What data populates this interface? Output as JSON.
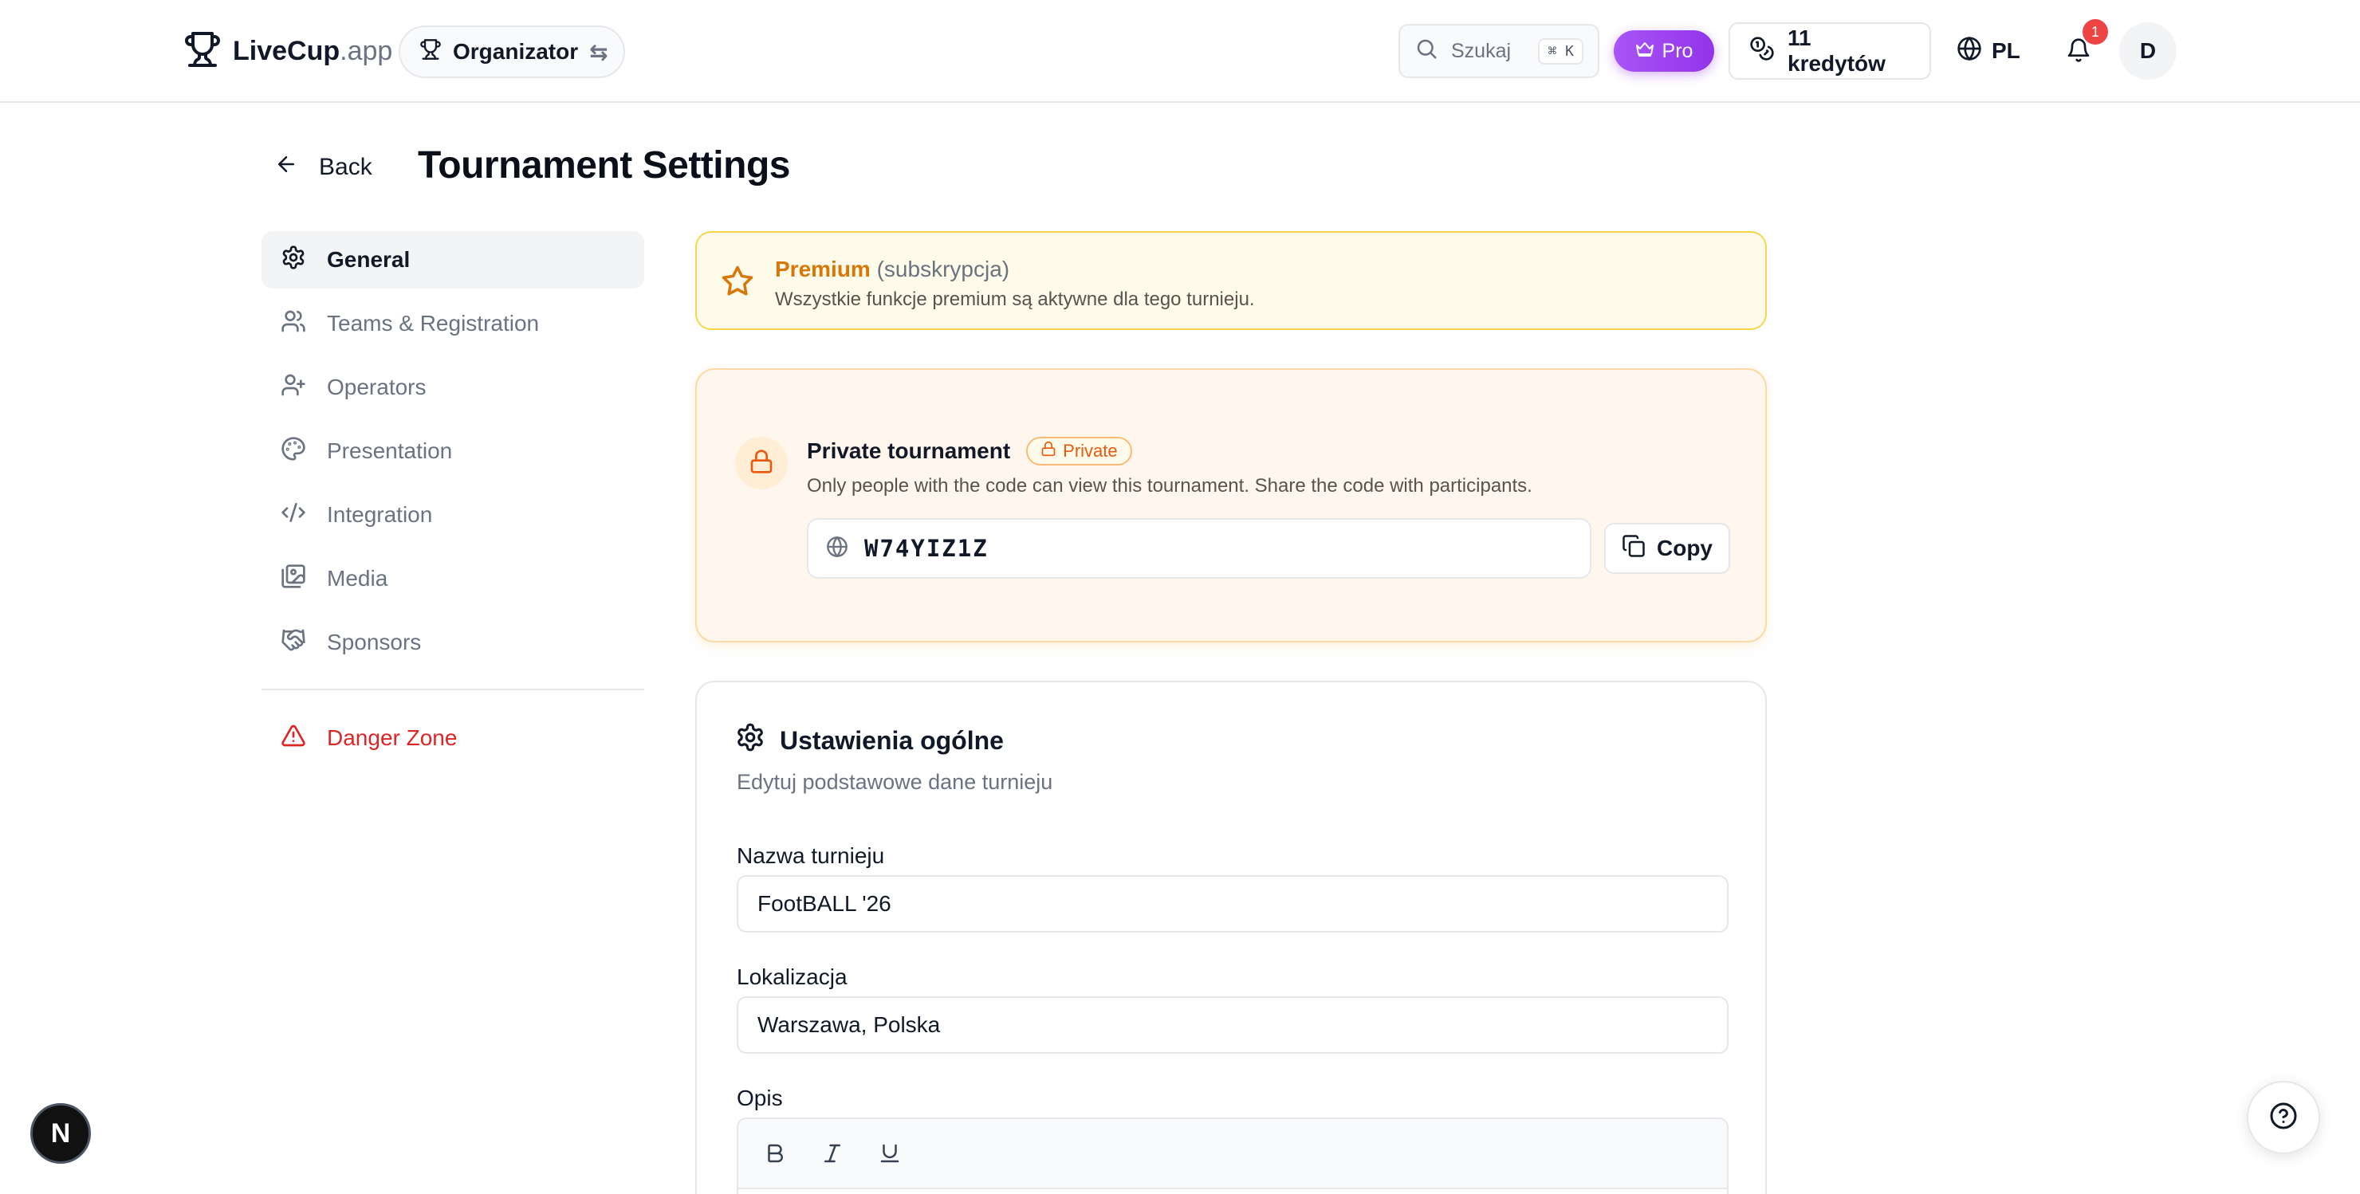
{
  "header": {
    "brand": "LiveCup",
    "brand_suffix": ".app",
    "role_label": "Organizator",
    "search_placeholder": "Szukaj",
    "search_shortcut": "⌘ K",
    "pro_label": "Pro",
    "credits_label": "11 kredytów",
    "language": "PL",
    "notifications_count": "1",
    "avatar_initial": "D"
  },
  "page": {
    "back_label": "Back",
    "title": "Tournament Settings"
  },
  "sidebar": {
    "items": [
      {
        "label": "General",
        "icon": "gear-icon",
        "active": true
      },
      {
        "label": "Teams & Registration",
        "icon": "users-icon"
      },
      {
        "label": "Operators",
        "icon": "user-plus-icon"
      },
      {
        "label": "Presentation",
        "icon": "palette-icon"
      },
      {
        "label": "Integration",
        "icon": "code-icon"
      },
      {
        "label": "Media",
        "icon": "images-icon"
      },
      {
        "label": "Sponsors",
        "icon": "handshake-icon"
      }
    ],
    "danger": {
      "label": "Danger Zone",
      "icon": "warning-icon"
    }
  },
  "premium": {
    "title": "Premium",
    "subtitle": "(subskrypcja)",
    "description": "Wszystkie funkcje premium są aktywne dla tego turnieju."
  },
  "private": {
    "title": "Private tournament",
    "badge": "Private",
    "description": "Only people with the code can view this tournament. Share the code with participants.",
    "code": "W74YIZ1Z",
    "copy_label": "Copy"
  },
  "general": {
    "title": "Ustawienia ogólne",
    "description": "Edytuj podstawowe dane turnieju",
    "name_label": "Nazwa turnieju",
    "name_value": "FootBALL '26",
    "location_label": "Lokalizacja",
    "location_value": "Warszawa, Polska",
    "description_label": "Opis"
  },
  "floating": {
    "next_label": "N"
  },
  "colors": {
    "accent_pro": "#a855f7",
    "premium": "#d97706",
    "private": "#ea580c",
    "danger": "#dc2626"
  }
}
